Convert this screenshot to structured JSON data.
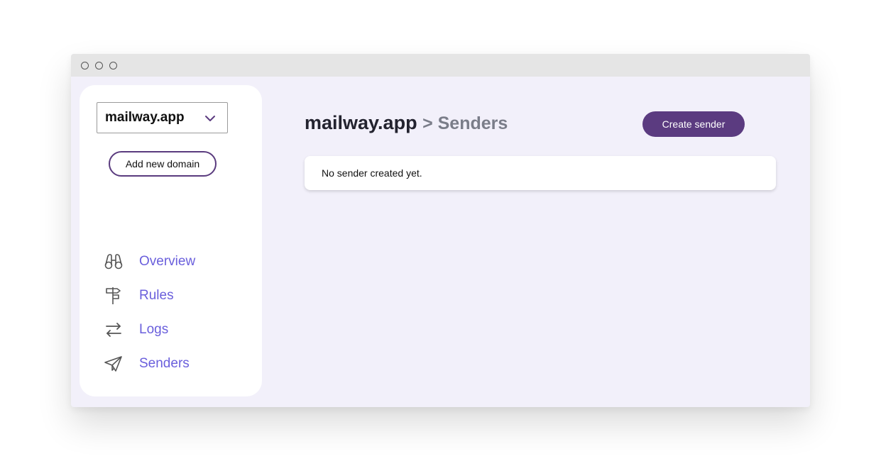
{
  "window": {
    "controls": [
      "close",
      "minimize",
      "maximize"
    ]
  },
  "sidebar": {
    "domain_select": {
      "value": "mailway.app",
      "icon": "chevron-down-icon"
    },
    "add_domain_label": "Add new domain",
    "nav": [
      {
        "label": "Overview",
        "icon": "binoculars-icon"
      },
      {
        "label": "Rules",
        "icon": "signpost-icon"
      },
      {
        "label": "Logs",
        "icon": "arrows-exchange-icon"
      },
      {
        "label": "Senders",
        "icon": "paper-plane-icon"
      }
    ]
  },
  "main": {
    "title": "mailway.app",
    "breadcrumb": "> Senders",
    "create_button_label": "Create sender",
    "empty_message": "No sender created yet."
  },
  "colors": {
    "accent": "#5b3b80",
    "nav_link": "#6a5fdc",
    "background": "#f2f0fa"
  }
}
